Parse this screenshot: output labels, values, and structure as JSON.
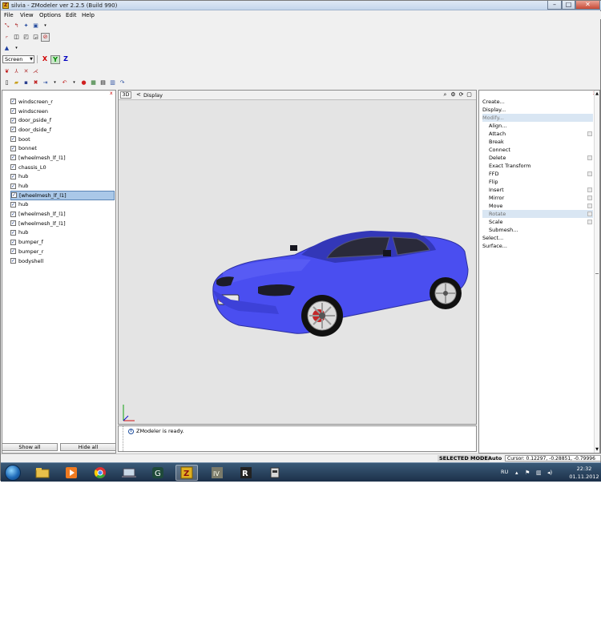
{
  "window": {
    "title": "silvia - ZModeler ver 2.2.5 (Build 990)",
    "min": "–",
    "max": "□",
    "close": "✕"
  },
  "menu": [
    "File",
    "View",
    "Options",
    "Edit",
    "Help"
  ],
  "toolbar": {
    "screen_select": "Screen",
    "axis_x": "X",
    "axis_y": "Y",
    "axis_z": "Z"
  },
  "left_panel": {
    "close": "x",
    "items": [
      "windscreen_r",
      "windscreen",
      "door_pside_f",
      "door_dside_f",
      "boot",
      "bonnet",
      "[wheelmesh_lf_l1]",
      "chassis_L0",
      "hub",
      "hub",
      "[wheelmesh_lf_l1]",
      "hub",
      "[wheelmesh_lf_l1]",
      "[wheelmesh_lf_l1]",
      "hub",
      "bumper_f",
      "bumper_r",
      "bodyshell"
    ],
    "show_all": "Show all",
    "hide_all": "Hide all"
  },
  "viewport": {
    "mode": "3D",
    "arrow": "<",
    "display": "Display",
    "car_color": "#4a4ef0"
  },
  "console": {
    "message": "ZModeler is ready.",
    "icon": "i"
  },
  "right_panel": {
    "close": "x",
    "commands": [
      "Create...",
      "Display...",
      "Modify..."
    ],
    "modify_items": [
      "Align...",
      "Attach",
      "Break",
      "Connect",
      "Delete",
      "Exact Transform",
      "FFD",
      "Flip",
      "Insert",
      "Mirror",
      "Move",
      "Rotate",
      "Scale",
      "Submesh..."
    ],
    "bottom_commands": [
      "Select...",
      "Surface..."
    ]
  },
  "statusbar": {
    "mode": "SELECTED MODE",
    "auto": "Auto",
    "cursor": "Cursor: 0.12297, -0.28851, -0.79996"
  },
  "taskbar": {
    "lang": "RU",
    "time": "22:32",
    "date": "01.11.2012"
  }
}
